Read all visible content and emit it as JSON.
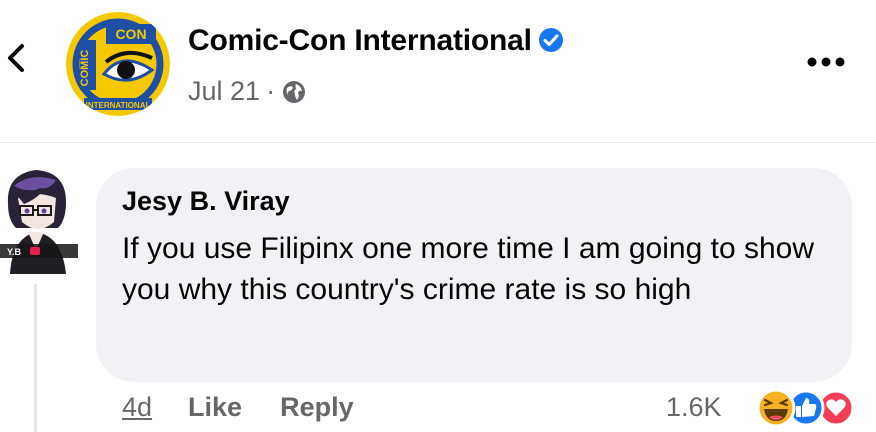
{
  "post": {
    "page_name": "Comic-Con International",
    "date": "Jul 21",
    "separator": "·",
    "logo_text": "COMIC CON",
    "logo_sub": "INTERNATIONAL",
    "icons": {
      "back": "chevron-left-icon",
      "verified": "verified-badge-icon",
      "audience": "globe-icon",
      "more": "more-options-icon"
    }
  },
  "comment": {
    "author": "Jesy B. Viray",
    "text": "If you use Filipinx one more time I am going to show you why this country's crime rate is so high",
    "time": "4d",
    "like_label": "Like",
    "reply_label": "Reply",
    "reaction_count": "1.6K",
    "reactions": [
      "haha",
      "like",
      "love"
    ],
    "avatar_badge_text": "Y.B"
  },
  "colors": {
    "bubble": "#f0f2f5",
    "secondary_text": "#65676b",
    "verified_blue": "#1877f2",
    "logo_yellow": "#f5c800",
    "logo_blue": "#1f4fa5",
    "love_red": "#f33e58",
    "haha_yellow": "#f7b125"
  }
}
